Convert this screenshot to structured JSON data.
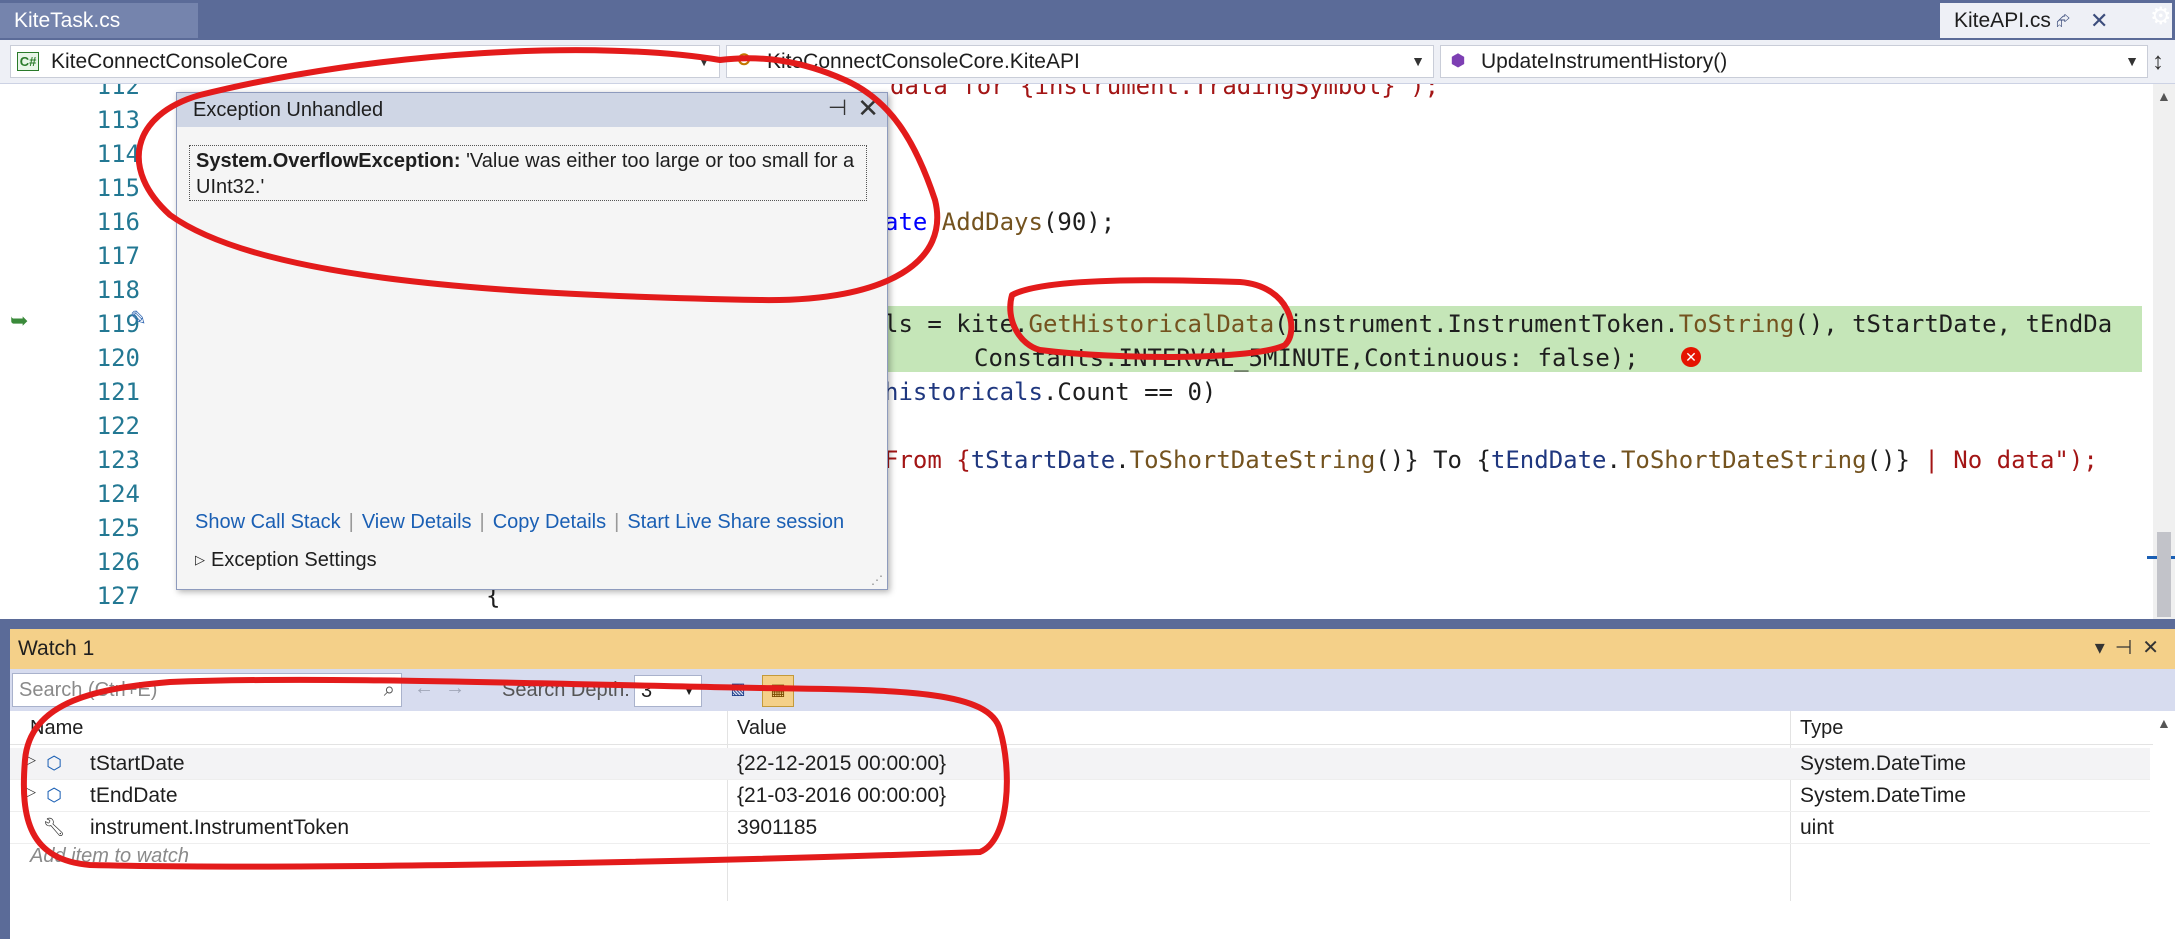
{
  "tabs": {
    "left_tab": "KiteTask.cs",
    "right_tab": "KiteAPI.cs"
  },
  "navbar": {
    "project": "KiteConnectConsoleCore",
    "class": "KiteConnectConsoleCore.KiteAPI",
    "member": "UpdateInstrumentHistory()"
  },
  "editor": {
    "line_numbers": [
      "112",
      "113",
      "114",
      "115",
      "116",
      "117",
      "118",
      "119",
      "120",
      "121",
      "122",
      "123",
      "124",
      "125",
      "126",
      "127"
    ],
    "lines": {
      "l112": "data for {instrument.TradingSymbol}\");",
      "l116_a": "ate ",
      "l116_b": "AddDays",
      "l116_c": "(90);",
      "l119_a": "ls = kite.",
      "l119_b": "GetHistoricalData",
      "l119_c": "(instrument.InstrumentToken.",
      "l119_d": "ToString",
      "l119_e": "(), tStartDate, tEndDa",
      "l120": "Constants.INTERVAL_5MINUTE,Continuous: false);",
      "l121_a": "historicals",
      "l121_b": ".Count == 0)",
      "l123_a": "From {",
      "l123_b": "tStartDate",
      "l123_c": ".",
      "l123_d": "ToShortDateString",
      "l123_e": "()} To {",
      "l123_f": "tEndDate",
      "l123_g": ".",
      "l123_h": "ToShortDateString",
      "l123_i": "()} ",
      "l123_j": "| No data\");",
      "l127": "{"
    }
  },
  "exception_popup": {
    "title": "Exception Unhandled",
    "exception_type": "System.OverflowException:",
    "exception_message": "'Value was either too large or too small for a UInt32.'",
    "links": [
      "Show Call Stack",
      "View Details",
      "Copy Details",
      "Start Live Share session"
    ],
    "settings": "Exception Settings"
  },
  "watch": {
    "title": "Watch 1",
    "search_placeholder": "Search (Ctrl+E)",
    "depth_label": "Search Depth:",
    "depth_value": "3",
    "columns": [
      "Name",
      "Value",
      "Type"
    ],
    "rows": [
      {
        "name": "tStartDate",
        "value": "{22-12-2015 00:00:00}",
        "type": "System.DateTime",
        "icon": "struct-icon"
      },
      {
        "name": "tEndDate",
        "value": "{21-03-2016 00:00:00}",
        "type": "System.DateTime",
        "icon": "struct-icon"
      },
      {
        "name": "instrument.InstrumentToken",
        "value": "3901185",
        "type": "uint",
        "icon": "wrench-icon"
      }
    ],
    "add_item": "Add item to watch"
  },
  "colors": {
    "accent": "#5b6b98",
    "watch_header": "#f4d089",
    "annotation": "#e31b1b",
    "current_line": "#c5e6b8"
  }
}
